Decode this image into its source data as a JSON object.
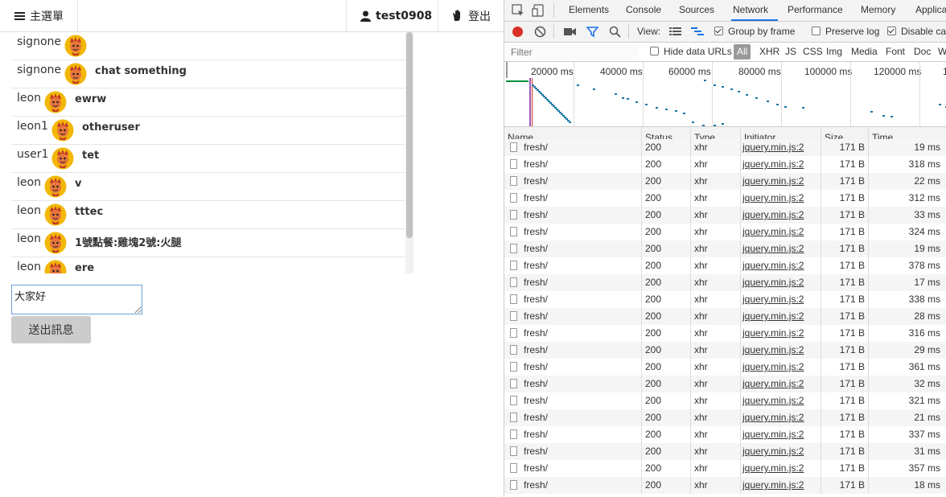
{
  "app": {
    "navbar": {
      "menu_label": "主選單",
      "username": "test0908",
      "logout_label": "登出"
    },
    "messages": [
      {
        "user": "signone",
        "text": ""
      },
      {
        "user": "signone",
        "text": "chat something"
      },
      {
        "user": "leon",
        "text": "ewrw"
      },
      {
        "user": "leon1",
        "text": "otheruser"
      },
      {
        "user": "user1",
        "text": "tet"
      },
      {
        "user": "leon",
        "text": "v"
      },
      {
        "user": "leon",
        "text": "tttec"
      },
      {
        "user": "leon",
        "text": "1號點餐:雞塊2號:火腿"
      },
      {
        "user": "leon",
        "text": "ere"
      }
    ],
    "input_value": "大家好",
    "send_label": "送出訊息"
  },
  "devtools": {
    "tabs": [
      "Elements",
      "Console",
      "Sources",
      "Network",
      "Performance",
      "Memory",
      "Applica"
    ],
    "active_tab": "Network",
    "toolbar": {
      "view_label": "View:",
      "group_by_frame": "Group by frame",
      "preserve_log": "Preserve log",
      "disable_cache": "Disable cac"
    },
    "filter": {
      "placeholder": "Filter",
      "hide_data_urls": "Hide data URLs",
      "types": [
        "All",
        "XHR",
        "JS",
        "CSS",
        "Img",
        "Media",
        "Font",
        "Doc",
        "W"
      ]
    },
    "timeline_labels": [
      "20000 ms",
      "40000 ms",
      "60000 ms",
      "80000 ms",
      "100000 ms",
      "120000 ms",
      "1"
    ],
    "columns": [
      "Name",
      "Status",
      "Type",
      "Initiator",
      "Size",
      "Time"
    ],
    "rows": [
      {
        "name": "fresh/",
        "status": "200",
        "type": "xhr",
        "initiator": "jquery.min.js:2",
        "size": "171 B",
        "time": "19 ms"
      },
      {
        "name": "fresh/",
        "status": "200",
        "type": "xhr",
        "initiator": "jquery.min.js:2",
        "size": "171 B",
        "time": "318 ms"
      },
      {
        "name": "fresh/",
        "status": "200",
        "type": "xhr",
        "initiator": "jquery.min.js:2",
        "size": "171 B",
        "time": "22 ms"
      },
      {
        "name": "fresh/",
        "status": "200",
        "type": "xhr",
        "initiator": "jquery.min.js:2",
        "size": "171 B",
        "time": "312 ms"
      },
      {
        "name": "fresh/",
        "status": "200",
        "type": "xhr",
        "initiator": "jquery.min.js:2",
        "size": "171 B",
        "time": "33 ms"
      },
      {
        "name": "fresh/",
        "status": "200",
        "type": "xhr",
        "initiator": "jquery.min.js:2",
        "size": "171 B",
        "time": "324 ms"
      },
      {
        "name": "fresh/",
        "status": "200",
        "type": "xhr",
        "initiator": "jquery.min.js:2",
        "size": "171 B",
        "time": "19 ms"
      },
      {
        "name": "fresh/",
        "status": "200",
        "type": "xhr",
        "initiator": "jquery.min.js:2",
        "size": "171 B",
        "time": "378 ms"
      },
      {
        "name": "fresh/",
        "status": "200",
        "type": "xhr",
        "initiator": "jquery.min.js:2",
        "size": "171 B",
        "time": "17 ms"
      },
      {
        "name": "fresh/",
        "status": "200",
        "type": "xhr",
        "initiator": "jquery.min.js:2",
        "size": "171 B",
        "time": "338 ms"
      },
      {
        "name": "fresh/",
        "status": "200",
        "type": "xhr",
        "initiator": "jquery.min.js:2",
        "size": "171 B",
        "time": "28 ms"
      },
      {
        "name": "fresh/",
        "status": "200",
        "type": "xhr",
        "initiator": "jquery.min.js:2",
        "size": "171 B",
        "time": "316 ms"
      },
      {
        "name": "fresh/",
        "status": "200",
        "type": "xhr",
        "initiator": "jquery.min.js:2",
        "size": "171 B",
        "time": "29 ms"
      },
      {
        "name": "fresh/",
        "status": "200",
        "type": "xhr",
        "initiator": "jquery.min.js:2",
        "size": "171 B",
        "time": "361 ms"
      },
      {
        "name": "fresh/",
        "status": "200",
        "type": "xhr",
        "initiator": "jquery.min.js:2",
        "size": "171 B",
        "time": "32 ms"
      },
      {
        "name": "fresh/",
        "status": "200",
        "type": "xhr",
        "initiator": "jquery.min.js:2",
        "size": "171 B",
        "time": "321 ms"
      },
      {
        "name": "fresh/",
        "status": "200",
        "type": "xhr",
        "initiator": "jquery.min.js:2",
        "size": "171 B",
        "time": "21 ms"
      },
      {
        "name": "fresh/",
        "status": "200",
        "type": "xhr",
        "initiator": "jquery.min.js:2",
        "size": "171 B",
        "time": "337 ms"
      },
      {
        "name": "fresh/",
        "status": "200",
        "type": "xhr",
        "initiator": "jquery.min.js:2",
        "size": "171 B",
        "time": "31 ms"
      },
      {
        "name": "fresh/",
        "status": "200",
        "type": "xhr",
        "initiator": "jquery.min.js:2",
        "size": "171 B",
        "time": "357 ms"
      },
      {
        "name": "fresh/",
        "status": "200",
        "type": "xhr",
        "initiator": "jquery.min.js:2",
        "size": "171 B",
        "time": "18 ms"
      }
    ]
  }
}
